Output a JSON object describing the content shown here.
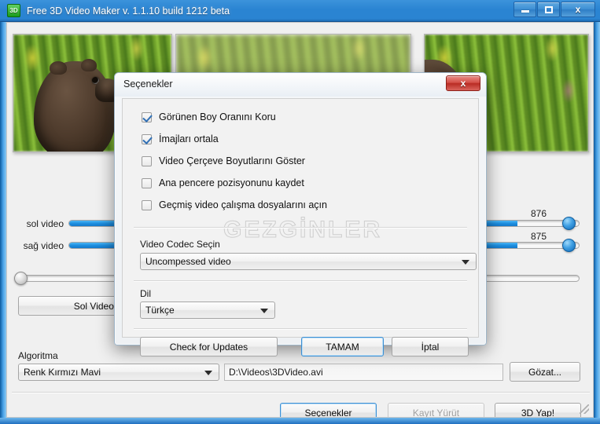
{
  "window": {
    "title": "Free 3D Video Maker  v. 1.1.10 build 1212 beta",
    "icon_label": "3D",
    "icon_name": "app-3d-icon",
    "minimize_label": "",
    "maximize_label": "",
    "close_label": "x",
    "accent_color": "#2a84d2",
    "frame_color": "#4aa3e8"
  },
  "previews": {
    "left_name": "left-video-preview",
    "center_name": "anaglyph-preview",
    "right_name": "right-video-preview"
  },
  "sliders": [
    {
      "label": "sol video",
      "value": "876",
      "fill_percent": 88,
      "name": "left-video-slider"
    },
    {
      "label": "sağ video",
      "value": "875",
      "fill_percent": 88,
      "name": "right-video-slider"
    },
    {
      "label": "",
      "value": "",
      "fill_percent": 0,
      "name": "depth-slider"
    }
  ],
  "main": {
    "open_left_video_label": "Sol Videoyu Aç",
    "algorithm_label": "Algoritma",
    "algorithm_value": "Renk Kırmızı Mavi",
    "output_path": "D:\\Videos\\3DVideo.avi",
    "browse_label": "Gözat...",
    "options_label": "Seçenekler",
    "record_label": "Kayıt Yürüt",
    "make3d_label": "3D Yap!"
  },
  "dialog": {
    "title": "Seçenekler",
    "close_label": "x",
    "close_color": "#c3392f",
    "watermark": "GEZGİNLER",
    "checkboxes": [
      {
        "label": "Görünen Boy Oranını Koru",
        "checked": true
      },
      {
        "label": "İmajları ortala",
        "checked": true
      },
      {
        "label": "Video Çerçeve Boyutlarını Göster",
        "checked": false
      },
      {
        "label": "Ana pencere pozisyonunu kaydet",
        "checked": false
      },
      {
        "label": "Geçmiş video çalışma dosyalarını açın",
        "checked": false
      }
    ],
    "codec_label": "Video Codec Seçin",
    "codec_value": "Uncompessed video",
    "language_label": "Dil",
    "language_value": "Türkçe",
    "check_updates_label": "Check for Updates",
    "ok_label": "TAMAM",
    "cancel_label": "İptal"
  }
}
